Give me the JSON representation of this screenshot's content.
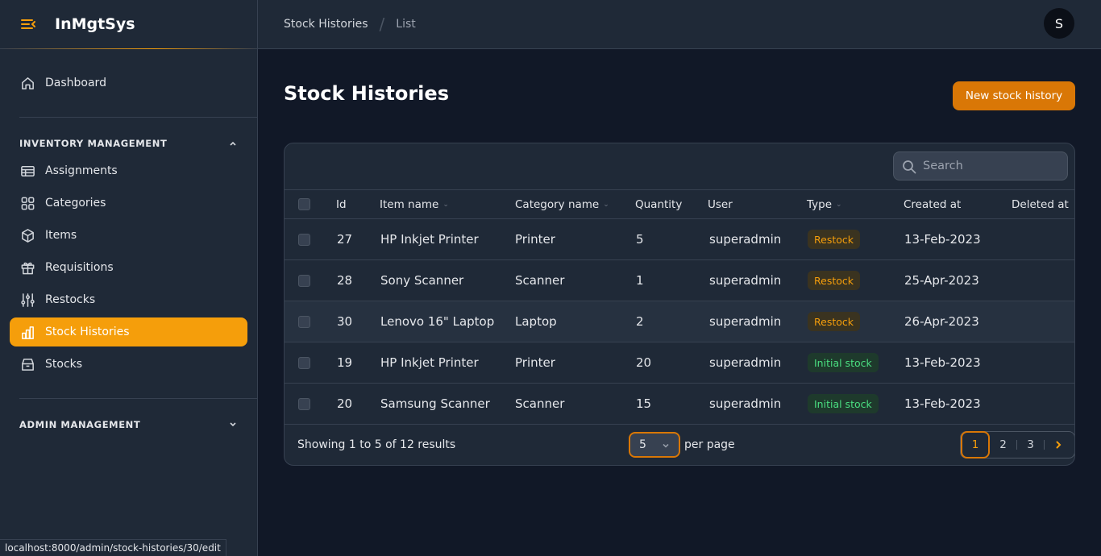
{
  "app": {
    "name": "InMgtSys"
  },
  "sidebar": {
    "dashboard": "Dashboard",
    "section_inventory": "INVENTORY MANAGEMENT",
    "items": [
      {
        "label": "Assignments",
        "icon": "table-icon"
      },
      {
        "label": "Categories",
        "icon": "grid-icon"
      },
      {
        "label": "Items",
        "icon": "cube-icon"
      },
      {
        "label": "Requisitions",
        "icon": "gift-icon"
      },
      {
        "label": "Restocks",
        "icon": "sliders-icon"
      },
      {
        "label": "Stock Histories",
        "icon": "chart-bar-icon",
        "active": true
      },
      {
        "label": "Stocks",
        "icon": "archive-icon"
      }
    ],
    "section_admin": "ADMIN MANAGEMENT"
  },
  "topbar": {
    "breadcrumb": [
      "Stock Histories",
      "List"
    ],
    "avatar_initial": "S"
  },
  "main": {
    "title": "Stock Histories",
    "new_button": "New stock history",
    "search_placeholder": "Search"
  },
  "table": {
    "columns": [
      "Id",
      "Item name",
      "Category name",
      "Quantity",
      "User",
      "Type",
      "Created at",
      "Deleted at"
    ],
    "rows": [
      {
        "id": "27",
        "item": "HP Inkjet Printer",
        "category": "Printer",
        "quantity": "5",
        "user": "superadmin",
        "type": "Restock",
        "created": "13-Feb-2023",
        "deleted": ""
      },
      {
        "id": "28",
        "item": "Sony Scanner",
        "category": "Scanner",
        "quantity": "1",
        "user": "superadmin",
        "type": "Restock",
        "created": "25-Apr-2023",
        "deleted": ""
      },
      {
        "id": "30",
        "item": "Lenovo 16\" Laptop",
        "category": "Laptop",
        "quantity": "2",
        "user": "superadmin",
        "type": "Restock",
        "created": "26-Apr-2023",
        "deleted": ""
      },
      {
        "id": "19",
        "item": "HP Inkjet Printer",
        "category": "Printer",
        "quantity": "20",
        "user": "superadmin",
        "type": "Initial stock",
        "created": "13-Feb-2023",
        "deleted": ""
      },
      {
        "id": "20",
        "item": "Samsung Scanner",
        "category": "Scanner",
        "quantity": "15",
        "user": "superadmin",
        "type": "Initial stock",
        "created": "13-Feb-2023",
        "deleted": ""
      }
    ]
  },
  "footer": {
    "showing": "Showing 1 to 5 of 12 results",
    "per_page_value": "5",
    "per_page_label": "per page",
    "pages": [
      "1",
      "2",
      "3"
    ],
    "current_page": "1"
  },
  "statusbar": {
    "url": "localhost:8000/admin/stock-histories/30/edit"
  },
  "colors": {
    "accent": "#f59e0b",
    "restock": "#f59e0b",
    "initial_stock": "#4ade80"
  }
}
